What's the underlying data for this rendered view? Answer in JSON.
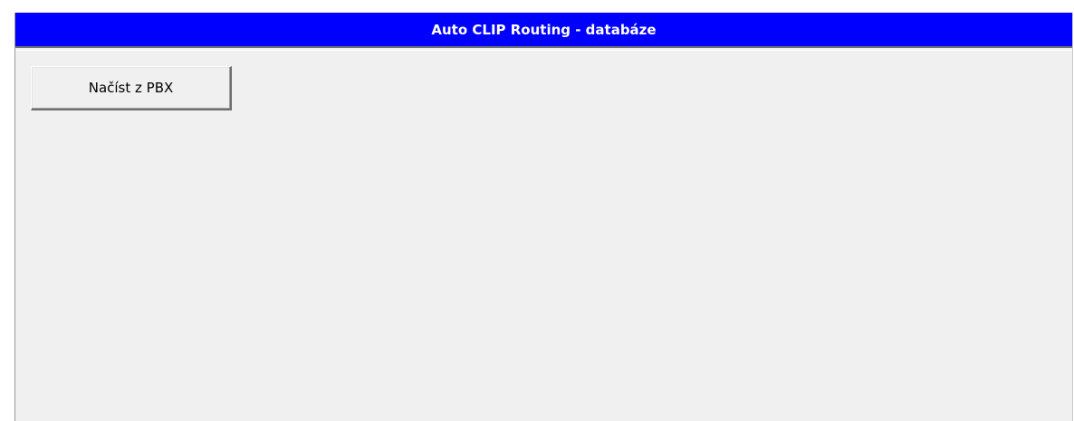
{
  "window": {
    "title": "Auto CLIP Routing - databáze",
    "title_bar_color": "#0000ff",
    "background_color": "#f0f0f0"
  },
  "toolbar": {
    "load_button_label": "Načíst z PBX"
  }
}
